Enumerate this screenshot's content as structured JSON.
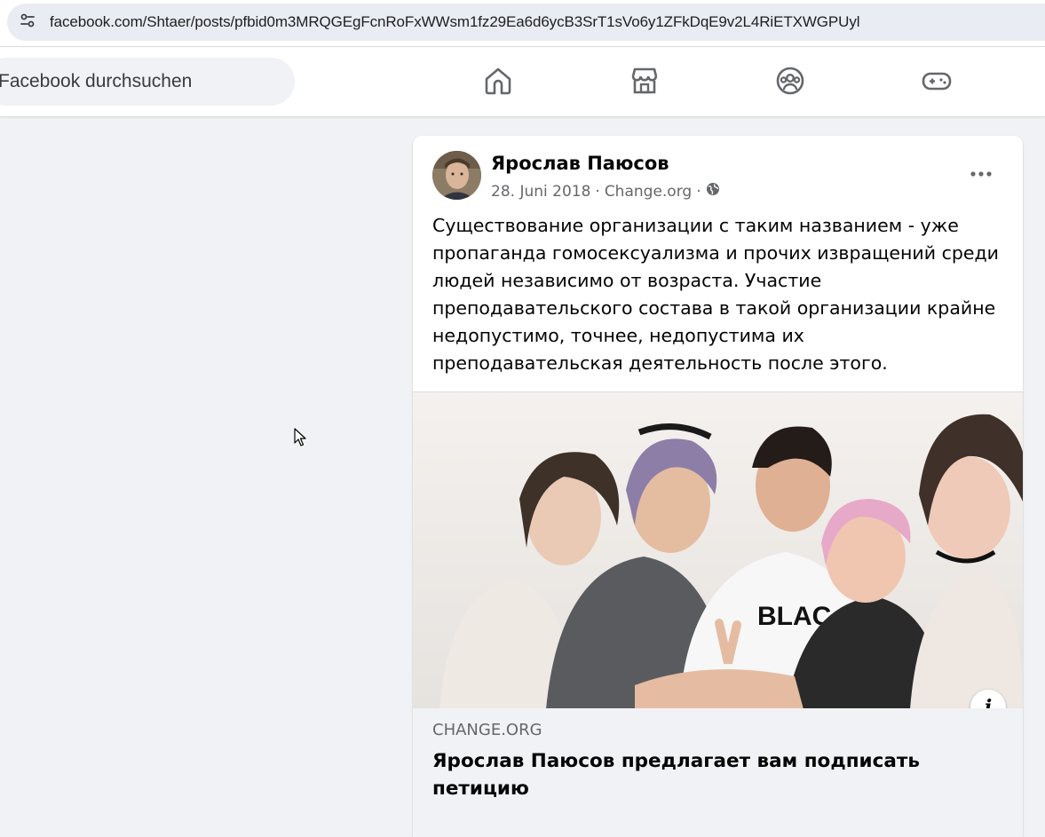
{
  "browser": {
    "url": "facebook.com/Shtaer/posts/pfbid0m3MRQGEgFcnRoFxWWsm1fz29Ea6d6ycB3SrT1sVo6y1ZFkDqE9v2L4RiETXWGPUyl",
    "site_info_icon": "tune-icon"
  },
  "nav": {
    "search_placeholder": "Facebook durchsuchen",
    "icons": [
      "home-icon",
      "marketplace-icon",
      "groups-icon",
      "gaming-icon"
    ]
  },
  "post": {
    "author": "Ярослав Паюсов",
    "date": "28. Juni 2018",
    "separator": "·",
    "source": "Change.org",
    "privacy_icon": "globe-icon",
    "text": "Существование организации с таким названием - уже пропаганда гомосексуализма и прочих извращений среди людей независимо от возраста. Участие преподавательского состава в такой организации крайне недопустимо, точнее, недопустима их преподавательская деятельность после этого.",
    "link": {
      "domain": "CHANGE.ORG",
      "title": "Ярослав Паюсов предлагает вам подписать петицию",
      "info_label": "i"
    }
  }
}
